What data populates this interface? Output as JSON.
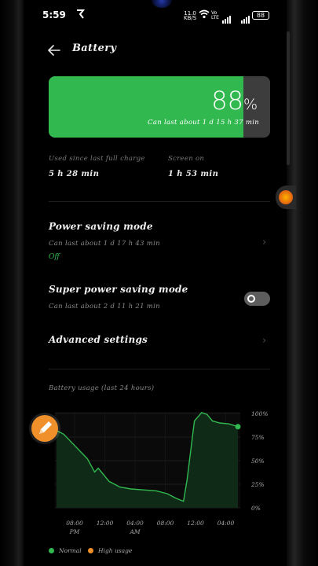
{
  "status_bar": {
    "time": "5:59",
    "carrier_icon": "carrier-glyph",
    "net_speed_value": "11.0",
    "net_speed_unit": "KB/S",
    "volte_top": "Vo",
    "volte_bottom": "LTE",
    "battery_level": "88"
  },
  "header": {
    "title": "Battery"
  },
  "battery_card": {
    "percent": "88",
    "percent_unit": "%",
    "percent_value": 88,
    "remaining": "Can last about 1 d 15 h 37 min",
    "colors": {
      "fill": "#31b950",
      "empty": "#3d3d3d"
    }
  },
  "stats": {
    "since_charge_label": "Used since last full charge",
    "since_charge_value": "5 h 28 min",
    "screen_on_label": "Screen on",
    "screen_on_value": "1 h 53 min"
  },
  "power_saving": {
    "title": "Power saving mode",
    "subtitle": "Can last about 1 d 17 h 43 min",
    "state": "Off"
  },
  "super_power_saving": {
    "title": "Super power saving mode",
    "subtitle": "Can last about 2 d 11 h 21 min",
    "enabled": false
  },
  "advanced": {
    "title": "Advanced settings"
  },
  "usage": {
    "title": "Battery usage (last 24 hours)"
  },
  "chart_data": {
    "type": "area",
    "x_tick_labels": [
      "08:00",
      "12:00",
      "04:00",
      "08:00",
      "12:00",
      "04:00"
    ],
    "x_tick_sublabels": [
      "PM",
      "",
      "AM",
      "",
      "",
      ""
    ],
    "y_tick_labels": [
      "100%",
      "75%",
      "50%",
      "25%",
      "0%"
    ],
    "ylim": [
      0,
      100
    ],
    "grid": true,
    "x": [
      0,
      0.04,
      0.1,
      0.17,
      0.21,
      0.23,
      0.29,
      0.35,
      0.41,
      0.48,
      0.55,
      0.61,
      0.66,
      0.7,
      0.72,
      0.76,
      0.8,
      0.83,
      0.86,
      0.9,
      0.95,
      1.0
    ],
    "values": [
      82,
      78,
      66,
      52,
      38,
      42,
      28,
      22,
      20,
      19,
      18,
      15,
      10,
      7,
      30,
      92,
      101,
      99,
      92,
      90,
      89,
      86
    ],
    "series": [
      {
        "name": "Normal",
        "color": "#31b950"
      },
      {
        "name": "High usage",
        "color": "#f0902a"
      }
    ]
  },
  "legend": {
    "normal": "Normal",
    "high": "High usage"
  }
}
